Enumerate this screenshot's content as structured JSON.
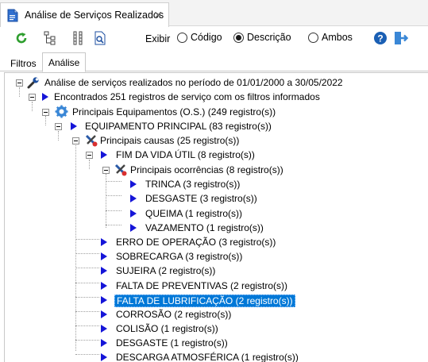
{
  "doc_tab": {
    "title": "Análise de Serviços Realizados",
    "close": "✕"
  },
  "toolbar": {
    "exibir_label": "Exibir",
    "options": [
      {
        "label": "Código",
        "checked": false
      },
      {
        "label": "Descrição",
        "checked": true
      },
      {
        "label": "Ambos",
        "checked": false
      }
    ],
    "help_glyph": "?"
  },
  "tabs": [
    {
      "label": "Filtros",
      "active": false
    },
    {
      "label": "Análise",
      "active": true
    }
  ],
  "colors": {
    "accent": "#0078d7",
    "arrow": "#1515d8",
    "refresh": "#2e9e2e",
    "help": "#1a5fb4"
  },
  "tree": {
    "root": "Análise de serviços realizados no período de 01/01/2000 a 30/05/2022",
    "found": "Encontrados 251 registros de serviço com os filtros informados",
    "equipments": "Principais Equipamentos (O.S.) (249 registro(s))",
    "equipment_main": "EQUIPAMENTO PRINCIPAL (83 registro(s))",
    "causes": "Principais causas (25 registro(s))",
    "cause_end_of_life": "FIM DA VIDA ÚTIL (8 registro(s))",
    "occurrences": "Principais ocorrências (8 registro(s))",
    "occurrence_items": [
      "TRINCA (3 registro(s))",
      "DESGASTE (3 registro(s))",
      "QUEIMA (1 registro(s))",
      "VAZAMENTO (1 registro(s))"
    ],
    "other_causes": [
      "ERRO DE OPERAÇÃO (3 registro(s))",
      "SOBRECARGA (3 registro(s))",
      "SUJEIRA (2 registro(s))",
      "FALTA DE PREVENTIVAS (2 registro(s))",
      "FALTA DE LUBRIFICAÇÃO (2 registro(s))",
      "CORROSÃO (2 registro(s))",
      "COLISÃO (1 registro(s))",
      "DESGASTE (1 registro(s))",
      "DESCARGA ATMOSFÉRICA (1 registro(s))"
    ],
    "selected_item": "FALTA DE LUBRIFICAÇÃO (2 registro(s))"
  }
}
